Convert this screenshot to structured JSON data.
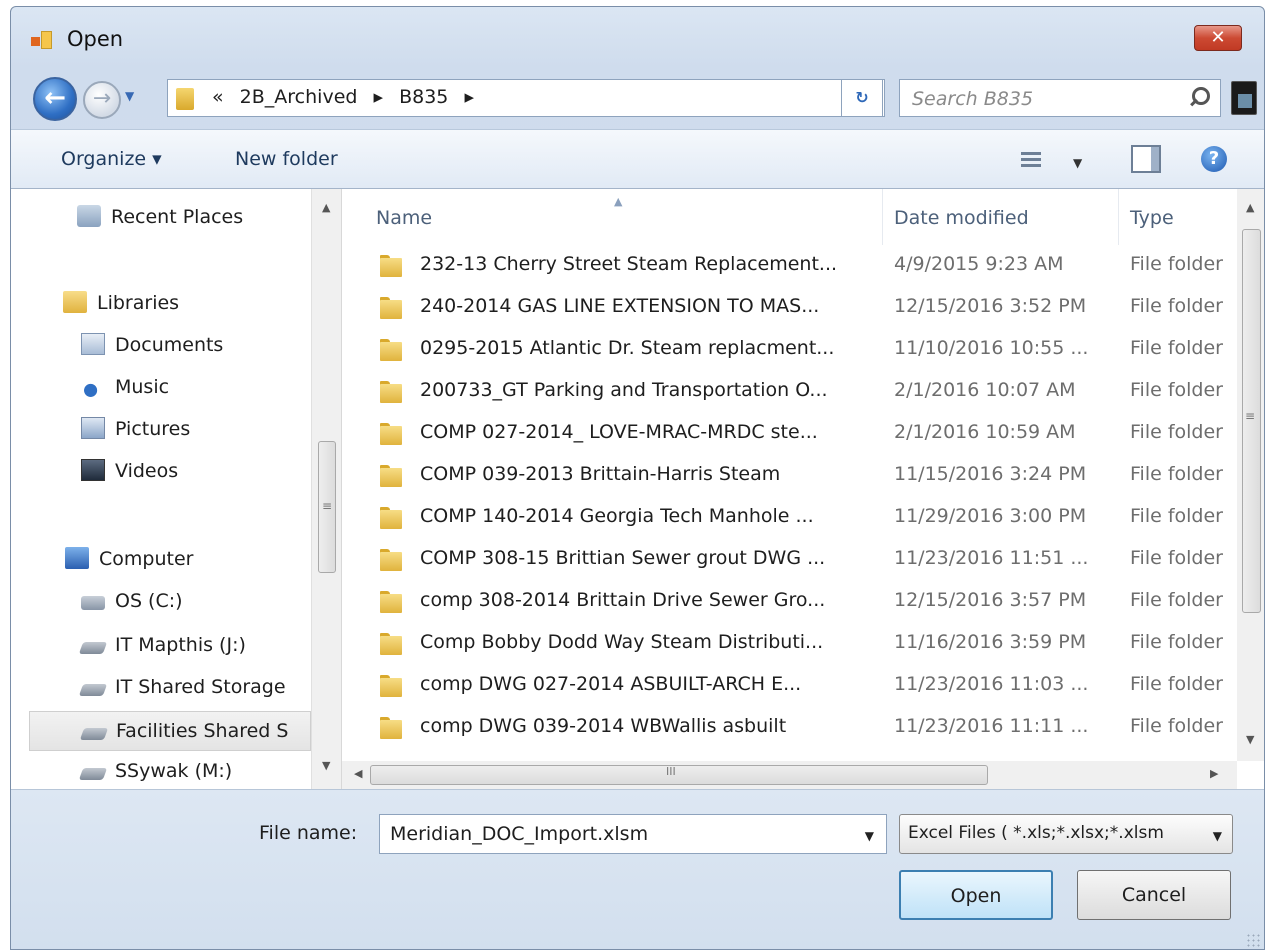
{
  "window": {
    "title": "Open",
    "close_label": "✕"
  },
  "address": {
    "overflow_marker": "«",
    "crumbs": [
      "2B_Archived",
      "▸",
      "B835",
      "▸"
    ],
    "search_placeholder": "Search B835"
  },
  "toolbar": {
    "organize_label": "Organize ▾",
    "new_folder_label": "New folder"
  },
  "nav": {
    "items": [
      {
        "label": "Recent Places",
        "icon": "recent-places-icon"
      },
      {
        "label": "Libraries",
        "icon": "libraries-icon"
      },
      {
        "label": "Documents",
        "icon": "documents-icon"
      },
      {
        "label": "Music",
        "icon": "music-icon"
      },
      {
        "label": "Pictures",
        "icon": "pictures-icon"
      },
      {
        "label": "Videos",
        "icon": "videos-icon"
      },
      {
        "label": "Computer",
        "icon": "computer-icon"
      },
      {
        "label": "OS (C:)",
        "icon": "drive-icon"
      },
      {
        "label": "IT Mapthis (J:)",
        "icon": "network-drive-icon"
      },
      {
        "label": "IT Shared Storage",
        "icon": "network-drive-icon"
      },
      {
        "label": "Facilities Shared S",
        "icon": "network-drive-icon",
        "selected": true
      },
      {
        "label": "SSywak (M:)",
        "icon": "network-drive-icon"
      }
    ]
  },
  "files": {
    "columns": {
      "name": "Name",
      "date": "Date modified",
      "type": "Type"
    },
    "rows": [
      {
        "name": "232-13 Cherry Street Steam Replacement...",
        "date": "4/9/2015 9:23 AM",
        "type": "File folder"
      },
      {
        "name": "240-2014 GAS LINE EXTENSION TO MAS...",
        "date": "12/15/2016 3:52 PM",
        "type": "File folder"
      },
      {
        "name": "0295-2015 Atlantic Dr. Steam replacment...",
        "date": "11/10/2016 10:55 ...",
        "type": "File folder"
      },
      {
        "name": "200733_GT Parking and Transportation O...",
        "date": "2/1/2016 10:07 AM",
        "type": "File folder"
      },
      {
        "name": "COMP 027-2014_ LOVE-MRAC-MRDC ste...",
        "date": "2/1/2016 10:59 AM",
        "type": "File folder"
      },
      {
        "name": "COMP 039-2013 Brittain-Harris Steam",
        "date": "11/15/2016 3:24 PM",
        "type": "File folder"
      },
      {
        "name": "COMP 140-2014 Georgia Tech Manhole ...",
        "date": "11/29/2016 3:00 PM",
        "type": "File folder"
      },
      {
        "name": "COMP 308-15 Brittian Sewer grout DWG ...",
        "date": "11/23/2016 11:51 ...",
        "type": "File folder"
      },
      {
        "name": "comp 308-2014 Brittain Drive Sewer Gro...",
        "date": "12/15/2016 3:57 PM",
        "type": "File folder"
      },
      {
        "name": "Comp Bobby Dodd Way Steam Distributi...",
        "date": "11/16/2016 3:59 PM",
        "type": "File folder"
      },
      {
        "name": "comp DWG  027-2014 ASBUILT-ARCH E...",
        "date": "11/23/2016 11:03 ...",
        "type": "File folder"
      },
      {
        "name": "comp DWG  039-2014 WBWallis asbuilt",
        "date": "11/23/2016 11:11 ...",
        "type": "File folder"
      }
    ]
  },
  "footer": {
    "file_name_label": "File name:",
    "file_name_value": "Meridian_DOC_Import.xlsm",
    "file_type_value": "Excel Files  ( *.xls;*.xlsx;*.xlsm",
    "open_label": "Open",
    "cancel_label": "Cancel"
  },
  "colors": {
    "window_chrome": "#d4e0ee",
    "close_red": "#cc4a33",
    "folder_yellow": "#e0b33d",
    "header_text": "#4c607a"
  }
}
